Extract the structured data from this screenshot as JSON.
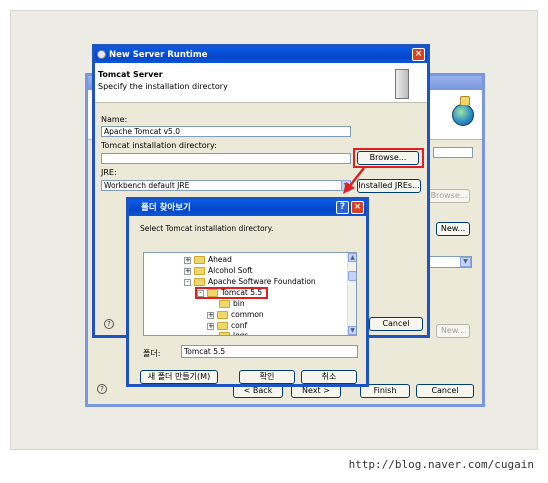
{
  "watermark": "http://blog.naver.com/cugain",
  "back_window": {
    "browse_label": "Browse...",
    "new_label_1": "New...",
    "new_label_2": "New...",
    "back_label": "< Back",
    "next_label": "Next >",
    "finish_label": "Finish",
    "cancel_label": "Cancel"
  },
  "server_dialog": {
    "title": "New Server Runtime",
    "header_title": "Tomcat Server",
    "header_subtitle": "Specify the installation directory",
    "name_label": "Name:",
    "name_value": "Apache Tomcat v5.0",
    "install_dir_label": "Tomcat installation directory:",
    "install_dir_value": "",
    "browse_label": "Browse...",
    "jre_label": "JRE:",
    "jre_value": "Workbench default JRE",
    "installed_jres_label": "Installed JREs...",
    "cancel_label": "Cancel"
  },
  "folder_dialog": {
    "title": "폴더 찾아보기",
    "instruction": "Select Tomcat installation directory.",
    "tree": [
      {
        "label": "Ahead",
        "expander": "+"
      },
      {
        "label": "Alcohol Soft",
        "expander": "+"
      },
      {
        "label": "Apache Software Foundation",
        "expander": "-"
      },
      {
        "label": "Tomcat 5.5",
        "expander": "-"
      },
      {
        "label": "bin",
        "expander": ""
      },
      {
        "label": "common",
        "expander": "+"
      },
      {
        "label": "conf",
        "expander": "+"
      },
      {
        "label": "logs",
        "expander": ""
      }
    ],
    "folder_label": "폴더:",
    "folder_value": "Tomcat 5.5",
    "new_folder_label": "새 폴더 만들기(M)",
    "ok_label": "확인",
    "cancel_label": "취소"
  },
  "colors": {
    "highlight": "#e02020",
    "title_active": "#0546c9",
    "title_inactive": "#7a96df"
  }
}
